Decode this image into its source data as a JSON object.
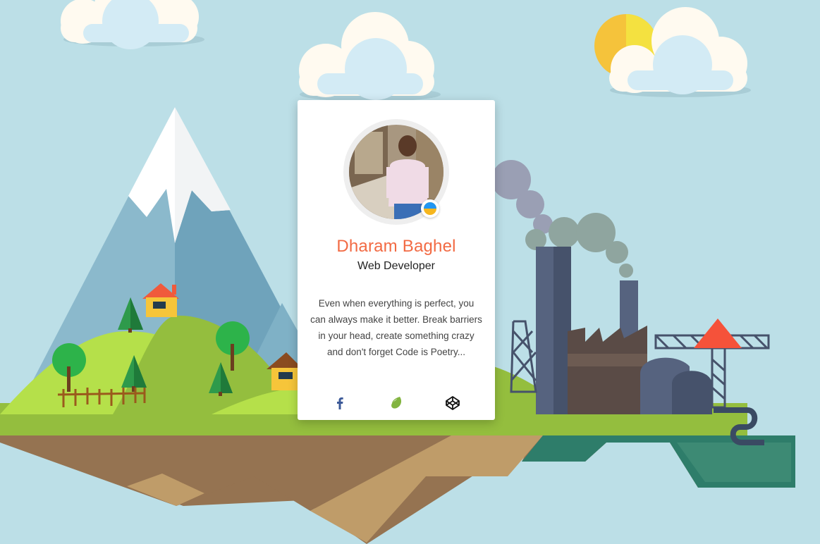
{
  "profile": {
    "name": "Dharam Baghel",
    "role": "Web Developer",
    "bio": "Even when everything is perfect, you can always make it better. Break barriers in your head, create something crazy and don't forget Code is Poetry...",
    "avatar_icon": "profile-photo",
    "status_icon": "blue-yellow-circle-icon"
  },
  "social": [
    {
      "icon": "facebook-icon",
      "color": "#3b5998"
    },
    {
      "icon": "envato-leaf-icon",
      "color": "#82b440"
    },
    {
      "icon": "codepen-icon",
      "color": "#111111"
    }
  ],
  "colors": {
    "sky": "#bcdfe7",
    "name_accent": "#f26a43",
    "grass": "#8bc34a",
    "water": "#2e7d6a"
  }
}
